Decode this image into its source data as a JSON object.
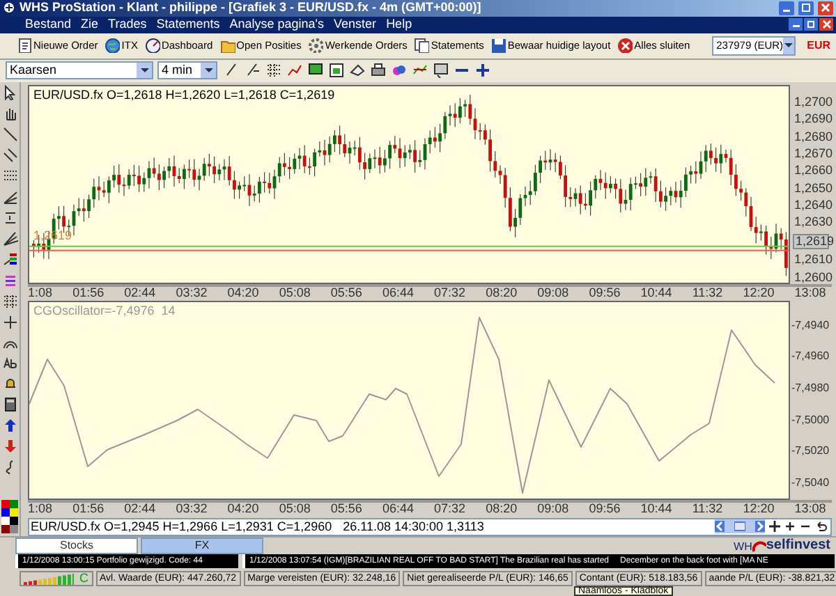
{
  "window": {
    "title": "WHS ProStation - Klant - philippe - [Grafiek 3 - EUR/USD.fx - 4m (GMT+00:00)]"
  },
  "menu": [
    "Bestand",
    "Zie",
    "Trades",
    "Statements",
    "Analyse pagina's",
    "Venster",
    "Help"
  ],
  "toolbar": {
    "buttons": [
      {
        "label": "Nieuwe Order",
        "kind": "order"
      },
      {
        "label": "ITX",
        "kind": "globe"
      },
      {
        "label": "Dashboard",
        "kind": "gauge"
      },
      {
        "label": "Open Posities",
        "kind": "folder"
      },
      {
        "label": "Werkende Orders",
        "kind": "gear"
      },
      {
        "label": "Statements",
        "kind": "pages"
      },
      {
        "label": "Bewaar huidige layout",
        "kind": "save"
      },
      {
        "label": "Alles sluiten",
        "kind": "close"
      }
    ],
    "account": "237979 (EUR)",
    "currency": "EUR"
  },
  "chart_toolbar": {
    "chart_type": "Kaarsen",
    "interval": "4 min"
  },
  "price_panel": {
    "legend": "EUR/USD.fx O=1,2618 H=1,2620 L=1,2618 C=1,2619",
    "line_label": "1,2619",
    "axis_labels": [
      {
        "text": "1,2700",
        "current": false
      },
      {
        "text": "1,2690",
        "current": false
      },
      {
        "text": "1,2680",
        "current": false
      },
      {
        "text": "1,2670",
        "current": false
      },
      {
        "text": "1,2660",
        "current": false
      },
      {
        "text": "1,2650",
        "current": false
      },
      {
        "text": "1,2640",
        "current": false
      },
      {
        "text": "1,2630",
        "current": false
      },
      {
        "text": "1,2619",
        "current": true
      },
      {
        "text": "1,2610",
        "current": false
      },
      {
        "text": "1,2600",
        "current": false
      }
    ],
    "time_labels": [
      "1:08",
      "01:56",
      "02:44",
      "03:32",
      "04:20",
      "05:08",
      "05:56",
      "06:44",
      "07:32",
      "08:20",
      "09:08",
      "09:56",
      "10:44",
      "11:32",
      "12:20",
      "13:08"
    ]
  },
  "oscillator_panel": {
    "legend": "CGOscillator=-7,4976  14",
    "axis_labels": [
      "-7,4940",
      "-7,4960",
      "-7,4980",
      "-7,5000",
      "-7,5020",
      "-7,5040"
    ],
    "time_labels": [
      "1:08",
      "01:56",
      "02:44",
      "03:32",
      "04:20",
      "05:08",
      "05:56",
      "06:44",
      "07:32",
      "08:20",
      "09:08",
      "09:56",
      "10:44",
      "11:32",
      "12:20",
      "13:08"
    ]
  },
  "chart_status": {
    "quote": "EUR/USD.fx O=1,2945 H=1,2966 L=1,2931 C=1,2960",
    "time": "26.11.08 14:30:00 1,3113"
  },
  "tabs": [
    {
      "label": "Stocks",
      "selected": false
    },
    {
      "label": "FX",
      "selected": true
    }
  ],
  "logo": {
    "prefix": "WH",
    "name": "selfinvest"
  },
  "ticker": {
    "left": "1/12/2008 13:00:15 Portfolio gewijzigd. Code: 44",
    "right": [
      "1/12/2008 13:07:54 (IGM)[BRAZILIAN REAL OFF TO BAD START] The Brazilian real has started",
      "December on the back foot with [MA NE"
    ]
  },
  "status_bar": {
    "connection": "C",
    "fields": [
      "Avl. Waarde (EUR): 447.260,72",
      "Marge vereisten (EUR): 32.248,16",
      "Niet gerealiseerde P/L (EUR): 146,65",
      "Contant (EUR): 518.183,56",
      "aande P/L (EUR): -38.821,32"
    ]
  },
  "tooltip": "Naamloos - Kladblok"
}
